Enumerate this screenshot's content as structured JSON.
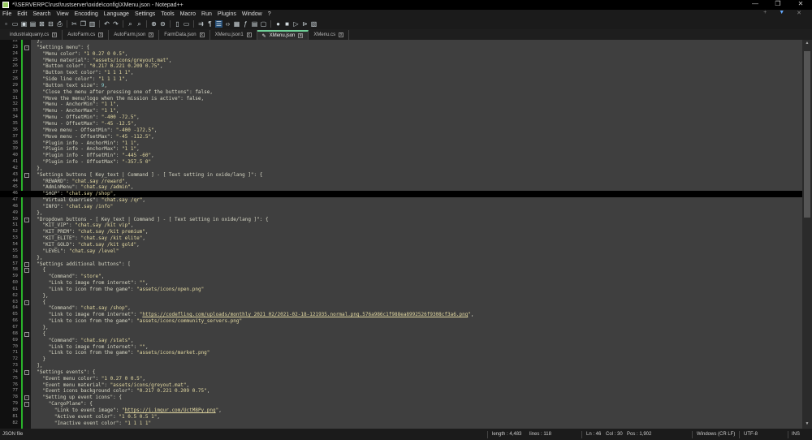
{
  "window": {
    "title": "*\\\\SERVERPC\\rust\\rustserver\\oxide\\config\\XMenu.json - Notepad++",
    "minimize": "—",
    "maximize": "❐",
    "close": "✕"
  },
  "menu": [
    "File",
    "Edit",
    "Search",
    "View",
    "Encoding",
    "Language",
    "Settings",
    "Tools",
    "Macro",
    "Run",
    "Plugins",
    "Window",
    "?"
  ],
  "menu_right": {
    "plus": "+",
    "dropdown": "▼",
    "close": "✕"
  },
  "toolbar": [
    "new-file",
    "open",
    "save",
    "save-all",
    "close",
    "close-all",
    "print",
    "cut",
    "copy",
    "paste",
    "undo",
    "redo",
    "find",
    "replace",
    "zoom-in",
    "zoom-out",
    "sync-v",
    "sync-h",
    "word-wrap",
    "show-all-chars",
    "indent-guide",
    "udl",
    "doc-map",
    "function-list",
    "folder-workspace",
    "monitor",
    "record",
    "stop",
    "play",
    "play-multiple",
    "save-macro"
  ],
  "tabs": [
    {
      "label": "industrialquarry.cs",
      "active": false
    },
    {
      "label": "AutoFarm.cs",
      "active": false
    },
    {
      "label": "AutoFarm.json",
      "active": false
    },
    {
      "label": "FarmData.json",
      "active": false
    },
    {
      "label": "XMenu.json1",
      "active": false
    },
    {
      "label": "XMenu.json",
      "active": true
    },
    {
      "label": "XMenu.cs",
      "active": false
    }
  ],
  "editor": {
    "current_line": 46,
    "lines": [
      {
        "n": 22,
        "t": "  },"
      },
      {
        "n": 23,
        "t": "  \"Settings menu\": {",
        "fold": true
      },
      {
        "n": 24,
        "t": "    \"Menu color\": \"1 0.27 0 0.5\","
      },
      {
        "n": 25,
        "t": "    \"Menu material\": \"assets/icons/greyout.mat\","
      },
      {
        "n": 26,
        "t": "    \"Button color\": \"0.217 0.221 0.209 0.75\","
      },
      {
        "n": 27,
        "t": "    \"Button text color\": \"1 1 1 1\","
      },
      {
        "n": 28,
        "t": "    \"Side line color\": \"1 1 1 1\","
      },
      {
        "n": 29,
        "t": "    \"Button text size\": 9,"
      },
      {
        "n": 30,
        "t": "    \"Close the menu after pressing one of the buttons\": false,"
      },
      {
        "n": 31,
        "t": "    \"Move the menu/logo when the mission is active\": false,"
      },
      {
        "n": 32,
        "t": "    \"Menu - AnchorMin\": \"1 1\","
      },
      {
        "n": 33,
        "t": "    \"Menu - AnchorMax\": \"1 1\","
      },
      {
        "n": 34,
        "t": "    \"Menu - OffsetMin\": \"-400 -72.5\","
      },
      {
        "n": 35,
        "t": "    \"Menu - OffsetMax\": \"-45 -12.5\","
      },
      {
        "n": 36,
        "t": "    \"Move menu - OffsetMin\": \"-400 -172.5\","
      },
      {
        "n": 37,
        "t": "    \"Move menu - OffsetMax\": \"-45 -112.5\","
      },
      {
        "n": 38,
        "t": "    \"Plugin info - AnchorMin\": \"1 1\","
      },
      {
        "n": 39,
        "t": "    \"Plugin info - AnchorMax\": \"1 1\","
      },
      {
        "n": 40,
        "t": "    \"Plugin info - OffsetMin\": \"-445 -60\","
      },
      {
        "n": 41,
        "t": "    \"Plugin info - OffsetMax\": \"-357.5 0\""
      },
      {
        "n": 42,
        "t": "  },"
      },
      {
        "n": 43,
        "t": "  \"Settings buttons [ Key_text | Command ] - [ Text setting in oxide/lang ]\": {",
        "fold": true
      },
      {
        "n": 44,
        "t": "    \"REWARD\": \"chat.say /reward\","
      },
      {
        "n": 45,
        "t": "    \"AdminMenu\": \"chat.say /admin\","
      },
      {
        "n": 46,
        "t": "    \"SHOP\": \"chat.say /shop\","
      },
      {
        "n": 47,
        "t": "    \"Virtual Quarries\": \"chat.say /qr\","
      },
      {
        "n": 48,
        "t": "    \"INFO\": \"chat.say /info\""
      },
      {
        "n": 49,
        "t": "  },"
      },
      {
        "n": 50,
        "t": "  \"Dropdown buttons - [ Key_text | Command ] - [ Text setting in oxide/lang ]\": {",
        "fold": true
      },
      {
        "n": 51,
        "t": "    \"KIT_VIP\": \"chat.say /kit vip\","
      },
      {
        "n": 52,
        "t": "    \"KIT_PREM\": \"chat.say /kit premium\","
      },
      {
        "n": 53,
        "t": "    \"KIT_ELITE\": \"chat.say /kit elite\","
      },
      {
        "n": 54,
        "t": "    \"KIT_GOLD\": \"chat.say /kit gold\","
      },
      {
        "n": 55,
        "t": "    \"LEVEL\": \"chat.say /level\""
      },
      {
        "n": 56,
        "t": "  },"
      },
      {
        "n": 57,
        "t": "  \"Settings additional buttons\": [",
        "fold": true
      },
      {
        "n": 58,
        "t": "    {",
        "fold": true
      },
      {
        "n": 59,
        "t": "      \"Command\": \"store\","
      },
      {
        "n": 60,
        "t": "      \"Link to image from internet\": \"\","
      },
      {
        "n": 61,
        "t": "      \"Link to icon from the game\": \"assets/icons/open.png\""
      },
      {
        "n": 62,
        "t": "    },"
      },
      {
        "n": 63,
        "t": "    {",
        "fold": true
      },
      {
        "n": 64,
        "t": "      \"Command\": \"chat.say /shop\","
      },
      {
        "n": 65,
        "t": "      \"Link to image from internet\": \"https://codefling.com/uploads/monthly_2021_02/2021-02-18-121935.normal.png.576a986c1f988ea8992526f9308cf3a6.png\","
      },
      {
        "n": 66,
        "t": "      \"Link to icon from the game\": \"assets/icons/community_servers.png\""
      },
      {
        "n": 67,
        "t": "    },"
      },
      {
        "n": 68,
        "t": "    {",
        "fold": true
      },
      {
        "n": 69,
        "t": "      \"Command\": \"chat.say /stats\","
      },
      {
        "n": 70,
        "t": "      \"Link to image from internet\": \"\","
      },
      {
        "n": 71,
        "t": "      \"Link to icon from the game\": \"assets/icons/market.png\""
      },
      {
        "n": 72,
        "t": "    }"
      },
      {
        "n": 73,
        "t": "  ],"
      },
      {
        "n": 74,
        "t": "  \"Settings events\": {",
        "fold": true
      },
      {
        "n": 75,
        "t": "    \"Event menu color\": \"1 0.27 0 0.5\","
      },
      {
        "n": 76,
        "t": "    \"Event menu material\": \"assets/icons/greyout.mat\","
      },
      {
        "n": 77,
        "t": "    \"Event icons background color\": \"0.217 0.221 0.209 0.75\","
      },
      {
        "n": 78,
        "t": "    \"Setting up event icons\": {",
        "fold": true
      },
      {
        "n": 79,
        "t": "      \"CargoPlane\": {",
        "fold": true
      },
      {
        "n": 80,
        "t": "        \"Link to event image\": \"https://i.imgur.com/UctM8Py.png\","
      },
      {
        "n": 81,
        "t": "        \"Active event color\": \"1 0.5 0.5 1\","
      },
      {
        "n": 82,
        "t": "        \"Inactive event color\": \"1 1 1 1\""
      }
    ]
  },
  "status": {
    "filetype": "JSON file",
    "length": "length : 4,483",
    "lines": "lines : 118",
    "ln": "Ln : 46",
    "col": "Col : 30",
    "pos": "Pos : 1,902",
    "eol": "Windows (CR LF)",
    "encoding": "UTF-8",
    "mode": "INS"
  },
  "colors": {
    "background": "#3f3f3f",
    "key": "#d6d6c4",
    "string": "#e3d9a2",
    "number": "#8cd0d3",
    "boolean": "#dfaf8f",
    "change_bar": "#2bb32b",
    "active_tab": "#6fcf97"
  }
}
